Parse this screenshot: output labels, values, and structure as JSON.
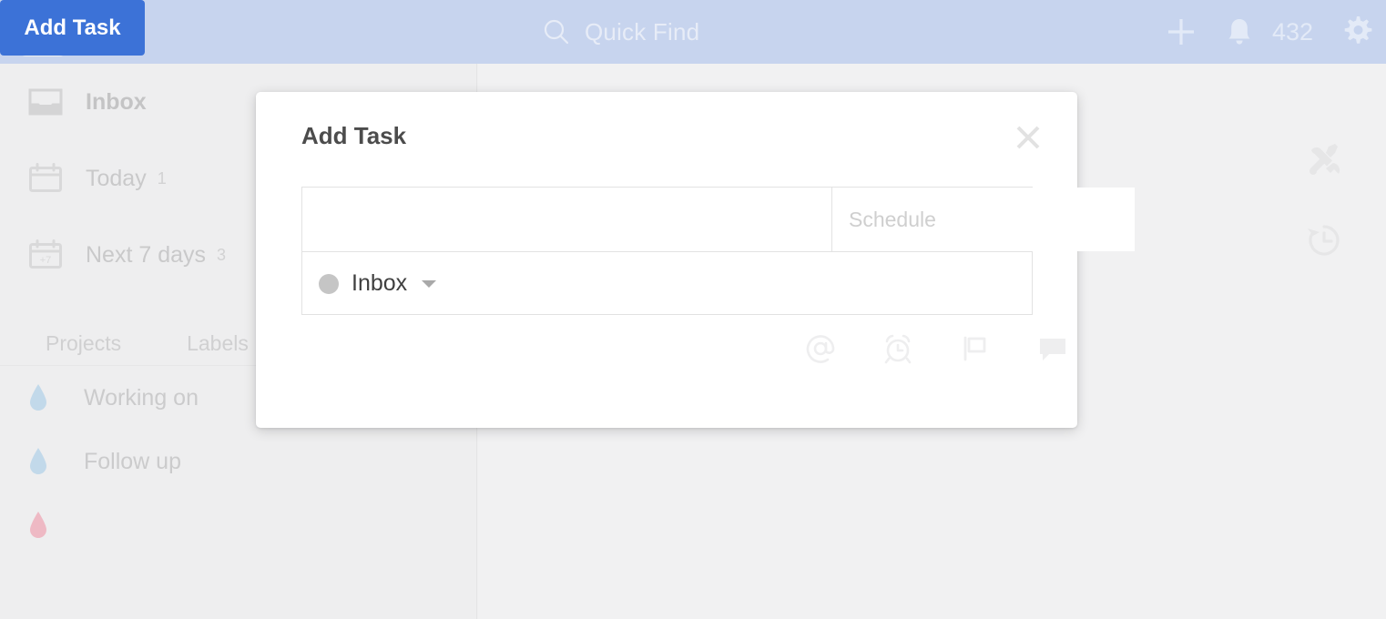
{
  "header": {
    "logo_name": "todoist-logo",
    "search": {
      "icon": "search-icon",
      "placeholder": "Quick Find"
    },
    "add_icon": "plus-icon",
    "bell_icon": "bell-icon",
    "notification_count": "432",
    "gear_icon": "gear-icon",
    "bg_color": "#c7d4ee",
    "text_color": "#e7ecf7"
  },
  "sidebar": {
    "nav": [
      {
        "label": "Inbox",
        "icon": "inbox-icon",
        "count": "",
        "bold": true
      },
      {
        "label": "Today",
        "icon": "calendar-icon",
        "count": "1",
        "bold": false
      },
      {
        "label": "Next 7 days",
        "icon": "calendar-7-icon",
        "count": "3",
        "bold": false
      }
    ],
    "tabs": [
      {
        "label": "Projects",
        "selected": true
      },
      {
        "label": "Labels",
        "selected": false
      }
    ],
    "projects": [
      {
        "label": "Working on",
        "icon": "drop-icon",
        "color": "#c2d9ea"
      },
      {
        "label": "Follow up",
        "icon": "drop-icon",
        "color": "#c2d9ea"
      },
      {
        "label": "",
        "icon": "drop-icon",
        "color": "#eeb9c4"
      }
    ]
  },
  "content": {
    "rail": [
      {
        "name": "tools-icon"
      },
      {
        "name": "history-icon"
      }
    ]
  },
  "modal": {
    "title": "Add Task",
    "close_icon": "close-icon",
    "task_input": {
      "value": "",
      "placeholder": ""
    },
    "schedule_input": {
      "value": "",
      "placeholder": "Schedule"
    },
    "project_selector": {
      "label": "Inbox",
      "dot_color": "#c5c5c5",
      "caret": "chevron-down-icon"
    },
    "submit_label": "Add Task",
    "submit_color": "#3c72d7",
    "tools": [
      {
        "name": "mention-icon"
      },
      {
        "name": "reminder-alarm-icon"
      },
      {
        "name": "priority-flag-icon"
      },
      {
        "name": "comment-icon"
      }
    ]
  }
}
